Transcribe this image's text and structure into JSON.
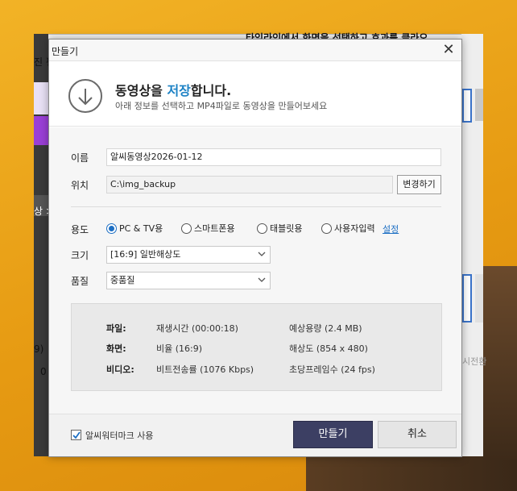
{
  "background": {
    "top_text": "타임라인에서 화면을 선택하고 효과를 클라오",
    "left_fragments": [
      "진 편",
      "상 >",
      "9)",
      "0"
    ],
    "right_fragment": "시전환",
    "colors": {
      "orange": "#f2b326",
      "app_bg": "#f3f3f3"
    }
  },
  "dialog": {
    "title": "만들기",
    "close_icon": "close-icon",
    "header": {
      "heading_prefix": "동영상을 ",
      "heading_accent": "저장",
      "heading_suffix": "합니다.",
      "subtitle": "아래 정보를 선택하고 MP4파일로 동영상을 만들어보세요",
      "icon": "download-arrow-icon"
    },
    "name": {
      "label": "이름",
      "value": "알씨동영상2026-01-12"
    },
    "location": {
      "label": "위치",
      "value": "C:\\img_backup",
      "change_button": "변경하기"
    },
    "usage": {
      "label": "용도",
      "options": [
        {
          "label": "PC & TV용",
          "selected": true
        },
        {
          "label": "스마트폰용",
          "selected": false
        },
        {
          "label": "태블릿용",
          "selected": false
        },
        {
          "label": "사용자입력",
          "selected": false
        }
      ],
      "settings_link": "설정"
    },
    "size": {
      "label": "크기",
      "value": "[16:9] 일반해상도"
    },
    "quality": {
      "label": "품질",
      "value": "중품질"
    },
    "info": {
      "file_label": "파일:",
      "file_duration": "재생시간 (00:00:18)",
      "file_size": "예상용량 (2.4 MB)",
      "screen_label": "화면:",
      "screen_ratio": "비율 (16:9)",
      "screen_resolution": "해상도 (854 x 480)",
      "video_label": "비디오:",
      "video_bitrate": "비트전송률 (1076 Kbps)",
      "video_fps": "초당프레임수 (24 fps)"
    },
    "footer": {
      "watermark_label": "알씨워터마크 사용",
      "watermark_checked": true,
      "create_button": "만들기",
      "cancel_button": "취소"
    },
    "colors": {
      "accent": "#1d82c5",
      "primary_button": "#3c3f63"
    }
  }
}
